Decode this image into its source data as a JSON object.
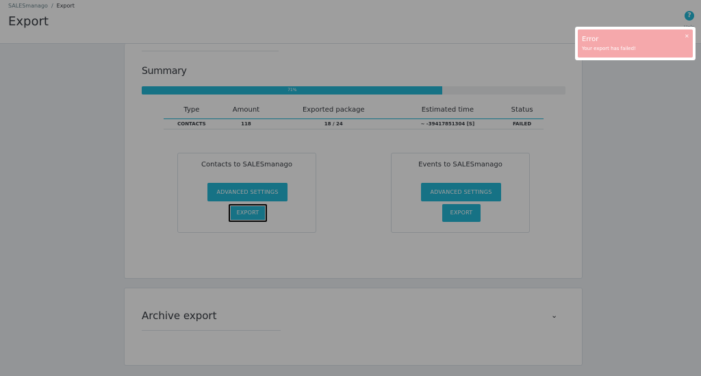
{
  "header": {
    "breadcrumb": [
      "SALESmanago",
      "Export"
    ],
    "breadcrumb_sep": "/",
    "title": "Export",
    "help_label": "Help",
    "help_icon": "?"
  },
  "summary": {
    "title": "Summary",
    "progress_percent": 71,
    "progress_label": "71%",
    "columns": [
      "Type",
      "Amount",
      "Exported package",
      "Estimated time",
      "Status"
    ],
    "rows": [
      [
        "CONTACTS",
        "118",
        "18 / 24",
        "~ -39417851304 [S]",
        "FAILED"
      ]
    ]
  },
  "contacts_box": {
    "title": "Contacts to SALESmanago",
    "advanced_label": "ADVANCED SETTINGS",
    "export_label": "EXPORT"
  },
  "events_box": {
    "title": "Events to SALESmanago",
    "advanced_label": "ADVANCED SETTINGS",
    "export_label": "EXPORT"
  },
  "archive": {
    "title": "Archive export",
    "chevron": "⌄"
  },
  "toast": {
    "title": "Error",
    "message": "Your export has failed!",
    "close": "×"
  },
  "colors": {
    "accent": "#25b9d7",
    "error": "#f5a8ab"
  }
}
